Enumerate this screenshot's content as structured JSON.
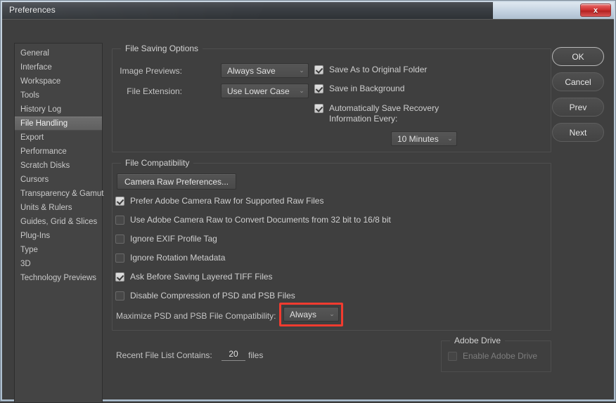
{
  "window": {
    "title": "Preferences",
    "close_label": "x"
  },
  "sidebar": {
    "items": [
      {
        "label": "General",
        "selected": false
      },
      {
        "label": "Interface",
        "selected": false
      },
      {
        "label": "Workspace",
        "selected": false
      },
      {
        "label": "Tools",
        "selected": false
      },
      {
        "label": "History Log",
        "selected": false
      },
      {
        "label": "File Handling",
        "selected": true
      },
      {
        "label": "Export",
        "selected": false
      },
      {
        "label": "Performance",
        "selected": false
      },
      {
        "label": "Scratch Disks",
        "selected": false
      },
      {
        "label": "Cursors",
        "selected": false
      },
      {
        "label": "Transparency & Gamut",
        "selected": false
      },
      {
        "label": "Units & Rulers",
        "selected": false
      },
      {
        "label": "Guides, Grid & Slices",
        "selected": false
      },
      {
        "label": "Plug-Ins",
        "selected": false
      },
      {
        "label": "Type",
        "selected": false
      },
      {
        "label": "3D",
        "selected": false
      },
      {
        "label": "Technology Previews",
        "selected": false
      }
    ]
  },
  "file_saving": {
    "group_title": "File Saving Options",
    "image_previews_label": "Image Previews:",
    "image_previews_value": "Always Save",
    "file_extension_label": "File Extension:",
    "file_extension_value": "Use Lower Case",
    "save_as_original_label": "Save As to Original Folder",
    "save_background_label": "Save in Background",
    "auto_recovery_label": "Automatically Save Recovery Information Every:",
    "auto_recovery_interval": "10 Minutes"
  },
  "file_compatibility": {
    "group_title": "File Compatibility",
    "camera_raw_button": "Camera Raw Preferences...",
    "prefer_acr_label": "Prefer Adobe Camera Raw for Supported Raw Files",
    "use_acr_convert_label": "Use Adobe Camera Raw to Convert Documents from 32 bit to 16/8 bit",
    "ignore_exif_label": "Ignore EXIF Profile Tag",
    "ignore_rotation_label": "Ignore Rotation Metadata",
    "ask_layered_tiff_label": "Ask Before Saving Layered TIFF Files",
    "disable_compression_label": "Disable Compression of PSD and PSB Files",
    "maximize_label": "Maximize PSD and PSB File Compatibility:",
    "maximize_value": "Always"
  },
  "footer": {
    "recent_label": "Recent File List Contains:",
    "recent_value": "20",
    "files_label": "files",
    "adobe_drive_group": "Adobe Drive",
    "enable_adobe_drive_label": "Enable Adobe Drive"
  },
  "buttons": {
    "ok": "OK",
    "cancel": "Cancel",
    "prev": "Prev",
    "next": "Next"
  },
  "icons": {
    "chevron": "⌄"
  },
  "colors": {
    "accent_highlight": "#f23b2f",
    "panel_bg": "#3f3f3f",
    "sidebar_bg": "#444444"
  }
}
